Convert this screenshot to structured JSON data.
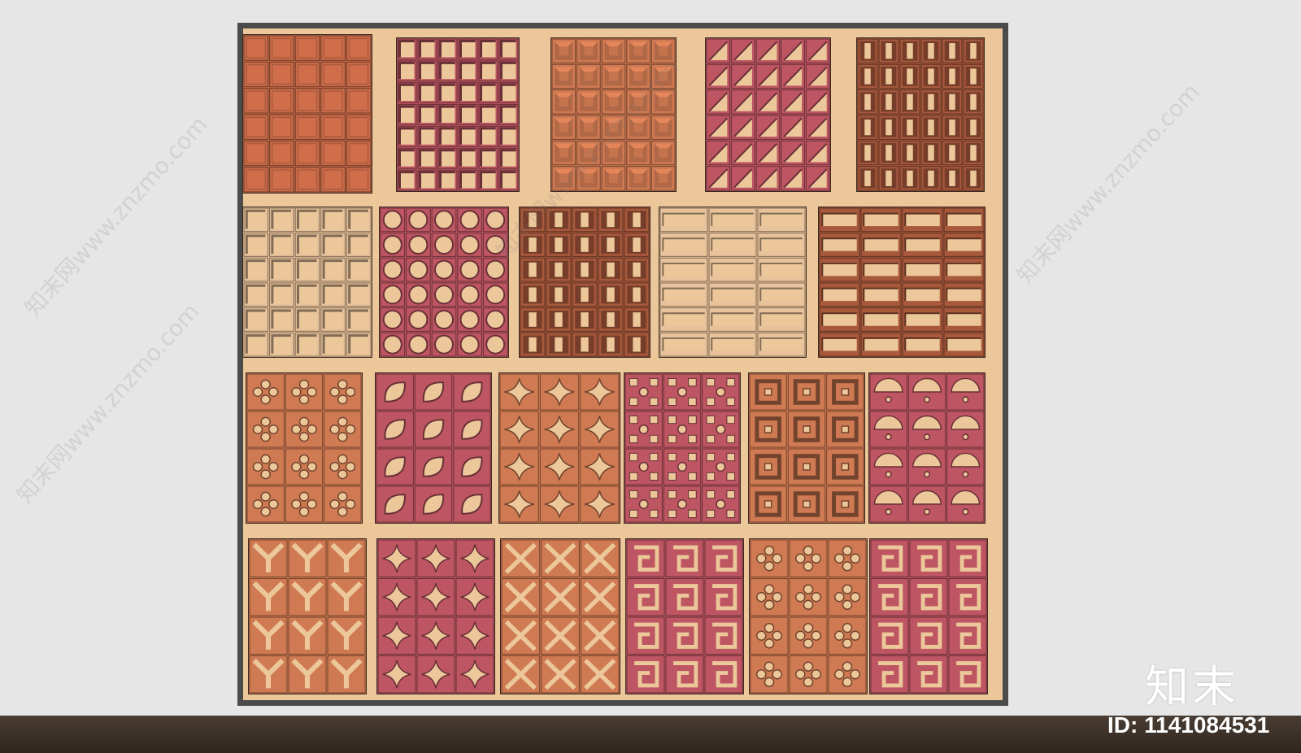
{
  "watermarks": [
    {
      "text": "知末网www.znzmo.com",
      "pos": "left-top"
    },
    {
      "text": "知末网www.znzmo.com",
      "pos": "left-bottom"
    },
    {
      "text": "知末网www.znzmo.com",
      "pos": "center-top"
    },
    {
      "text": "知末网www.znzmo.com",
      "pos": "right"
    }
  ],
  "logo_text": "知末",
  "id_label": "ID: 1141084531",
  "colors": {
    "wall": "#e6e6e6",
    "backing": "#ecc79a",
    "frame": "#4b4b4b",
    "terracotta": "#c86a48",
    "orange": "#cf7a52",
    "rose": "#bd5662",
    "brown": "#a8593c",
    "sand": "#e8c29a"
  },
  "panels": [
    {
      "name": "panel-grid-solid",
      "color": "terracotta",
      "pattern": "solid",
      "cols": 5,
      "rows": 6
    },
    {
      "name": "panel-grid-open-rose",
      "color": "rose",
      "pattern": "square",
      "cols": 6,
      "rows": 7
    },
    {
      "name": "panel-grid-bevel",
      "color": "orange",
      "pattern": "bevel",
      "cols": 5,
      "rows": 6
    },
    {
      "name": "panel-grid-diagonal",
      "color": "rose",
      "pattern": "diagonal",
      "cols": 5,
      "rows": 6
    },
    {
      "name": "panel-grid-slot",
      "color": "brown",
      "pattern": "slot",
      "cols": 6,
      "rows": 6
    },
    {
      "name": "panel-grid-open-sand",
      "color": "sand",
      "pattern": "square",
      "cols": 5,
      "rows": 6
    },
    {
      "name": "panel-grid-circle",
      "color": "rose",
      "pattern": "circle",
      "cols": 5,
      "rows": 6
    },
    {
      "name": "panel-grid-deep",
      "color": "brown",
      "pattern": "slot",
      "cols": 5,
      "rows": 6
    },
    {
      "name": "panel-grid-wide",
      "color": "sand",
      "pattern": "wide",
      "cols": 3,
      "rows": 6
    },
    {
      "name": "panel-grid-rect",
      "color": "brown",
      "pattern": "wide",
      "cols": 4,
      "rows": 6
    },
    {
      "name": "panel-flower",
      "color": "orange",
      "pattern": "flower",
      "cols": 3,
      "rows": 4
    },
    {
      "name": "panel-leaf",
      "color": "rose",
      "pattern": "leaf",
      "cols": 3,
      "rows": 4
    },
    {
      "name": "panel-star",
      "color": "orange",
      "pattern": "star",
      "cols": 3,
      "rows": 4
    },
    {
      "name": "panel-cross",
      "color": "rose",
      "pattern": "cross",
      "cols": 3,
      "rows": 4
    },
    {
      "name": "panel-square-ring",
      "color": "orange",
      "pattern": "ring",
      "cols": 3,
      "rows": 4
    },
    {
      "name": "panel-arch",
      "color": "rose",
      "pattern": "arch",
      "cols": 3,
      "rows": 4
    },
    {
      "name": "panel-y-cut",
      "color": "orange",
      "pattern": "ycut",
      "cols": 3,
      "rows": 4
    },
    {
      "name": "panel-diamond",
      "color": "rose",
      "pattern": "star",
      "cols": 3,
      "rows": 4
    },
    {
      "name": "panel-x-cut",
      "color": "orange",
      "pattern": "xcut",
      "cols": 3,
      "rows": 4
    },
    {
      "name": "panel-fret",
      "color": "rose",
      "pattern": "fret",
      "cols": 3,
      "rows": 4
    },
    {
      "name": "panel-starburst",
      "color": "orange",
      "pattern": "flower",
      "cols": 3,
      "rows": 4
    },
    {
      "name": "panel-fret-rose",
      "color": "rose",
      "pattern": "fret",
      "cols": 3,
      "rows": 4
    }
  ]
}
